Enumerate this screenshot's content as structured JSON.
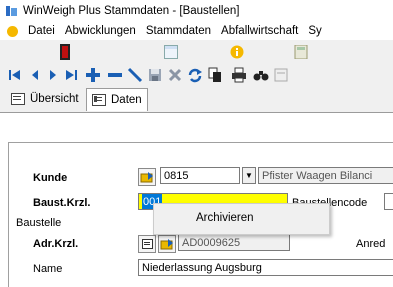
{
  "window": {
    "title": "WinWeigh Plus Stammdaten - [Baustellen]"
  },
  "menu": {
    "items": [
      "Datei",
      "Abwicklungen",
      "Stammdaten",
      "Abfallwirtschaft",
      "Sy"
    ]
  },
  "tabs": [
    {
      "label": "Übersicht",
      "active": false
    },
    {
      "label": "Daten",
      "active": true
    }
  ],
  "form": {
    "kunde_label": "Kunde",
    "kunde_number": "0815",
    "kunde_name": "Pfister Waagen Bilanci",
    "baust_krzl_label": "Baust.Krzl.",
    "baust_krzl_value": "001",
    "baustellencode_label": "Baustellencode",
    "group_label": "Baustelle",
    "adr_krzl_label": "Adr.Krzl.",
    "adr_krzl_value": "AD0009625",
    "anrede_label": "Anred",
    "name_label": "Name",
    "name_value": "Niederlassung Augsburg"
  },
  "context_menu": {
    "items": [
      "Archivieren"
    ]
  },
  "colors": {
    "selection": "#0078d7",
    "highlight_field": "#ffff00"
  }
}
